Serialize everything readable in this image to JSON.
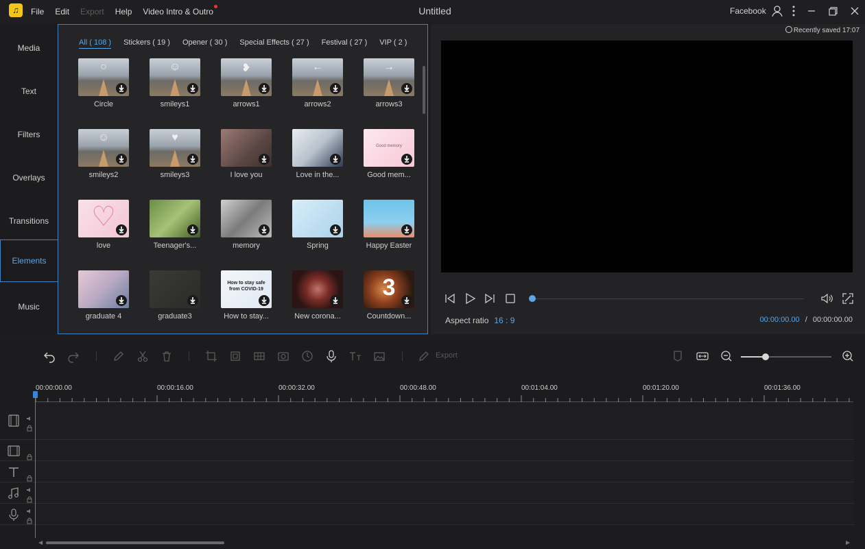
{
  "app": {
    "logo_glyph": "♫",
    "title": "Untitled",
    "account_label": "Facebook",
    "accent_color": "#5aa7e6",
    "brand_color": "#f5c518"
  },
  "menu": {
    "items": [
      "File",
      "Edit",
      "Export",
      "Help",
      "Video Intro & Outro"
    ]
  },
  "leftnav": {
    "items": [
      "Media",
      "Text",
      "Filters",
      "Overlays",
      "Transitions",
      "Elements",
      "Music"
    ],
    "active": "Elements"
  },
  "elements_panel": {
    "tabs": [
      "All ( 108 )",
      "Stickers ( 19 )",
      "Opener ( 30 )",
      "Special Effects ( 27 )",
      "Festival ( 27 )",
      "VIP ( 2 )"
    ],
    "active_tab": "All ( 108 )",
    "items": [
      {
        "label": "Circle",
        "thumb": "road",
        "glyph": "○"
      },
      {
        "label": "smileys1",
        "thumb": "road",
        "glyph": "☺"
      },
      {
        "label": "arrows1",
        "thumb": "road",
        "glyph": "❥"
      },
      {
        "label": "arrows2",
        "thumb": "road",
        "glyph": "←"
      },
      {
        "label": "arrows3",
        "thumb": "road",
        "glyph": "→"
      },
      {
        "label": "smileys2",
        "thumb": "road",
        "glyph": "☺"
      },
      {
        "label": "smileys3",
        "thumb": "road",
        "glyph": "♥"
      },
      {
        "label": "I love you",
        "thumb": "couple",
        "glyph": ""
      },
      {
        "label": "Love in the...",
        "thumb": "hands",
        "glyph": ""
      },
      {
        "label": "Good mem...",
        "thumb": "pink",
        "glyph": "Good memory"
      },
      {
        "label": "love",
        "thumb": "heart",
        "glyph": "♡"
      },
      {
        "label": "Teenager's...",
        "thumb": "leaves",
        "glyph": ""
      },
      {
        "label": "memory",
        "thumb": "gray",
        "glyph": ""
      },
      {
        "label": "Spring",
        "thumb": "sky",
        "glyph": ""
      },
      {
        "label": "Happy Easter",
        "thumb": "easter",
        "glyph": ""
      },
      {
        "label": "graduate 4",
        "thumb": "blossom",
        "glyph": ""
      },
      {
        "label": "graduate3",
        "thumb": "board",
        "glyph": ""
      },
      {
        "label": "How to stay...",
        "thumb": "covid",
        "glyph": "How to stay safe from COVID-19"
      },
      {
        "label": "New corona...",
        "thumb": "virus",
        "glyph": ""
      },
      {
        "label": "Countdown...",
        "thumb": "countdown",
        "glyph": "3"
      }
    ]
  },
  "preview": {
    "saved_status": "Recently saved 17:07",
    "aspect_label": "Aspect ratio",
    "aspect_value": "16 : 9",
    "current_time": "00:00:00.00",
    "separator": "/",
    "total_time": "00:00:00.00",
    "progress": 0
  },
  "timeline": {
    "export_label": "Export",
    "ruler_labels": [
      "00:00:00.00",
      "00:00:16.00",
      "00:00:32.00",
      "00:00:48.00",
      "00:01:04.00",
      "00:01:20.00",
      "00:01:36.00"
    ],
    "zoom_level": 0.27,
    "tracks": [
      "video",
      "overlay",
      "text",
      "music",
      "voice"
    ]
  }
}
